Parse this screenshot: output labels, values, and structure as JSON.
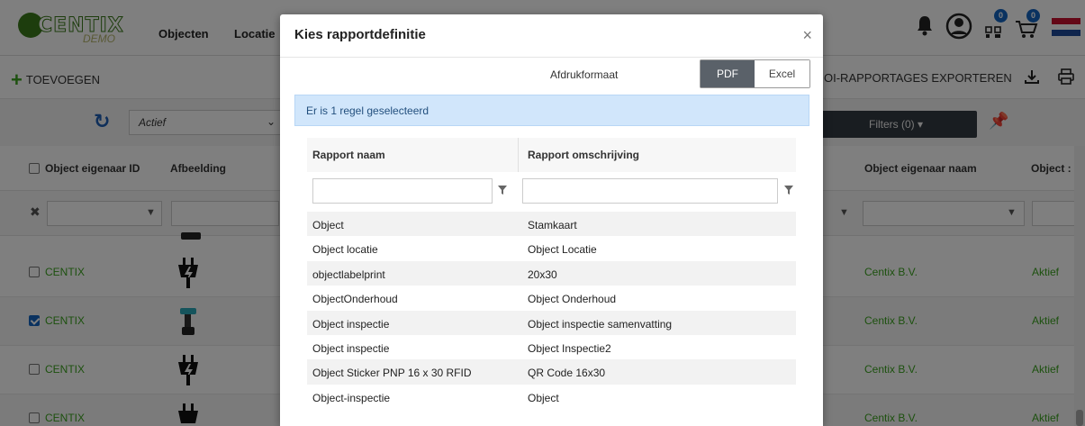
{
  "app": {
    "logo_text": "CENTIX",
    "logo_sub": "DEMO",
    "nav": [
      "Objecten",
      "Locatie"
    ],
    "badges": {
      "user": "0",
      "cart": "0"
    }
  },
  "toolbar": {
    "add_label": "TOEVOEGEN",
    "export_label": "OI-RAPPORTAGES EXPORTEREN"
  },
  "filterbar": {
    "status_value": "Actief",
    "filters_label": "Filters (0) ▾"
  },
  "table": {
    "headers": {
      "owner_id": "Object eigenaar ID",
      "image": "Afbeelding",
      "owner_name": "Object eigenaar naam",
      "status": "Object :"
    },
    "rows": [
      {
        "owner_id": "CENTIX",
        "checked": false,
        "owner_name": "Centix B.V.",
        "status": "Aktief"
      },
      {
        "owner_id": "CENTIX",
        "checked": true,
        "owner_name": "Centix B.V.",
        "status": "Aktief"
      },
      {
        "owner_id": "CENTIX",
        "checked": false,
        "owner_name": "Centix B.V.",
        "status": "Aktief"
      },
      {
        "owner_id": "CENTIX",
        "checked": false,
        "owner_name": "Centix B.V.",
        "status": "Aktief"
      }
    ]
  },
  "modal": {
    "title": "Kies rapportdefinitie",
    "close": "×",
    "format_label": "Afdrukformaat",
    "format_pdf": "PDF",
    "format_excel": "Excel",
    "format_selected": "PDF",
    "alert": "Er is 1 regel geselecteerd",
    "columns": {
      "name": "Rapport naam",
      "description": "Rapport omschrijving"
    },
    "reports": [
      {
        "name": "Object",
        "description": "Stamkaart"
      },
      {
        "name": "Object locatie",
        "description": "Object Locatie"
      },
      {
        "name": "objectlabelprint",
        "description": "20x30"
      },
      {
        "name": "ObjectOnderhoud",
        "description": "Object Onderhoud"
      },
      {
        "name": "Object inspectie",
        "description": "Object inspectie samenvatting"
      },
      {
        "name": "Object inspectie",
        "description": "Object Inspectie2"
      },
      {
        "name": "Object Sticker PNP 16 x 30 RFID",
        "description": "QR Code 16x30"
      },
      {
        "name": "Object-inspectie",
        "description": "Object"
      }
    ]
  }
}
